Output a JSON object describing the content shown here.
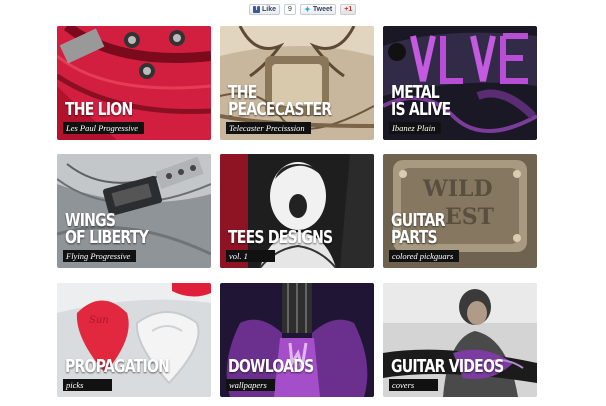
{
  "share": {
    "like_label": "Like",
    "like_count": "9",
    "tweet_label": "Tweet",
    "gplus_label": "+1"
  },
  "tiles": [
    {
      "title": "THE LION",
      "subtitle": "Les Paul Progressive"
    },
    {
      "title": "THE\nPEACECASTER",
      "subtitle": "Telecaster Precisssion"
    },
    {
      "title": "METAL\nIS ALIVE",
      "subtitle": "Ibanez Plain"
    },
    {
      "title": "WINGS\nOF LIBERTY",
      "subtitle": "Flying Progressive"
    },
    {
      "title": "TEES DESIGNS",
      "subtitle": "vol. 1"
    },
    {
      "title": "GUITAR\nPARTS",
      "subtitle": "colored pickguars"
    },
    {
      "title": "PROPAGATION",
      "subtitle": "picks"
    },
    {
      "title": "DOWLOADS",
      "subtitle": "wallpapers"
    },
    {
      "title": "GUITAR VIDEOS",
      "subtitle": "covers"
    }
  ],
  "colors": {
    "caption_bg": "#111111",
    "title_text": "#ffffff"
  }
}
